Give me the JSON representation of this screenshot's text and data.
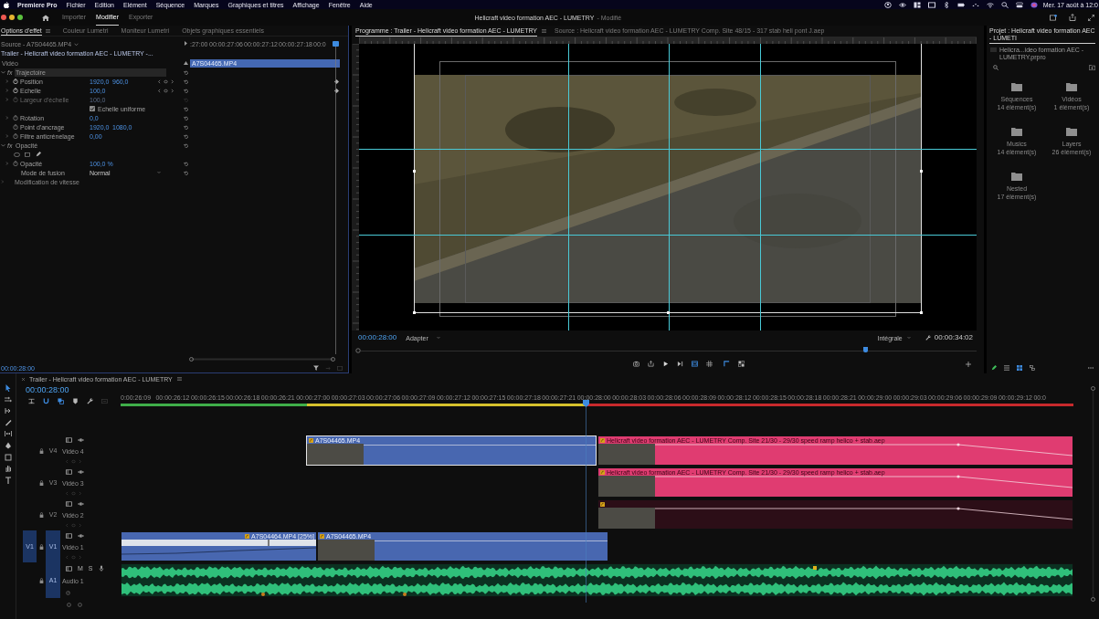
{
  "menu_bar": {
    "app_name": "Premiere Pro",
    "items": [
      "Fichier",
      "Edition",
      "Elément",
      "Séquence",
      "Marques",
      "Graphiques et titres",
      "Affichage",
      "Fenêtre",
      "Aide"
    ],
    "clock": "Mer. 17 août à 12:0"
  },
  "header": {
    "workspaces": [
      {
        "label": "Importer",
        "selected": false
      },
      {
        "label": "Modifier",
        "selected": true
      },
      {
        "label": "Exporter",
        "selected": false
      }
    ],
    "title": "Helicraft video formation AEC - LUMETRY",
    "title_state": "- Modifié"
  },
  "effect_panel": {
    "tabs": [
      {
        "label": "Options d'effet",
        "selected": true
      },
      {
        "label": "Couleur Lumetri",
        "selected": false
      },
      {
        "label": "Moniteur Lumetri",
        "selected": false
      },
      {
        "label": "Objets graphiques essentiels",
        "selected": false
      }
    ],
    "source": "Source - A7S04465.MP4",
    "sequence": "Trailer - Helicraft video formation AEC - LUMETRY -...",
    "rows": [
      {
        "kind": "section",
        "label": "Vidéo"
      },
      {
        "kind": "effect",
        "badge": "fx",
        "label": "Trajectoire",
        "expanded": true,
        "selected": true
      },
      {
        "kind": "param",
        "label": "Position",
        "values": [
          "1920,0",
          "960,0"
        ],
        "expandable": true,
        "animated": true,
        "disabled": false
      },
      {
        "kind": "param",
        "label": "Echelle",
        "values": [
          "100,0"
        ],
        "expandable": true,
        "animated": true,
        "disabled": false
      },
      {
        "kind": "param",
        "label": "Largeur d'échelle",
        "values": [
          "100,0"
        ],
        "expandable": true,
        "animated": false,
        "disabled": true
      },
      {
        "kind": "checkbox",
        "label": "Echelle uniforme",
        "checked": true
      },
      {
        "kind": "param",
        "label": "Rotation",
        "values": [
          "0,0"
        ],
        "expandable": true,
        "animated": false,
        "disabled": false
      },
      {
        "kind": "param",
        "label": "Point d'ancrage",
        "values": [
          "1920,0",
          "1080,0"
        ],
        "expandable": false,
        "animated": false,
        "disabled": false
      },
      {
        "kind": "param",
        "label": "Filtre anticrénelage",
        "values": [
          "0,00"
        ],
        "expandable": true,
        "animated": false,
        "disabled": false
      },
      {
        "kind": "effect",
        "badge": "fx",
        "label": "Opacité",
        "expanded": true,
        "selected": false
      },
      {
        "kind": "masks"
      },
      {
        "kind": "param",
        "label": "Opacité",
        "values": [
          "100,0 %"
        ],
        "expandable": true,
        "animated": false,
        "disabled": false
      },
      {
        "kind": "select",
        "label": "Mode de fusion",
        "value": "Normal"
      },
      {
        "kind": "group",
        "label": "Modification de vitesse",
        "expanded": false
      }
    ],
    "ruler": [
      ":27:00",
      "00:00:27:06",
      "00:00:27:12",
      "00:00:27:18",
      "00:0"
    ],
    "clip": "A7S04465.MP4",
    "timecode": "00:00:28:00"
  },
  "program_monitor": {
    "tabs": [
      {
        "label": "Programme : Trailer - Helicraft video formation AEC - LUMETRY",
        "selected": true
      },
      {
        "label": "Source : Helicraft video formation AEC - LUMETRY Comp. Site 48/15 - 317 stab heli pont J.aep",
        "selected": false
      }
    ],
    "timecode": "00:00:28:00",
    "zoom": "Adapter",
    "resolution": "Intégrale",
    "duration": "00:00:34:02",
    "level": 0.82
  },
  "project_panel": {
    "title": "Projet : Helicraft video formation AEC - LUMETI",
    "file": "Helicra...ideo formation AEC - LUMETRY.prpro",
    "bins": [
      {
        "name": "Séquences",
        "count": "14 élément(s)"
      },
      {
        "name": "Vidéos",
        "count": "1 élément(s)"
      },
      {
        "name": "Musics",
        "count": "14 élément(s)"
      },
      {
        "name": "Layers",
        "count": "26 élément(s)"
      },
      {
        "name": "Nested",
        "count": "17 élément(s)"
      }
    ]
  },
  "timeline": {
    "title": "Trailer - Helicraft video formation AEC - LUMETRY",
    "timecode": "00:00:28:00",
    "ruler": [
      "0:00:26:09",
      "00:00:26:12",
      "00:00:26:15",
      "00:00:26:18",
      "00:00:26:21",
      "00:00:27:00",
      "00:00:27:03",
      "00:00:27:06",
      "00:00:27:09",
      "00:00:27:12",
      "00:00:27:15",
      "00:00:27:18",
      "00:00:27:21",
      "00:00:28:00",
      "00:00:28:03",
      "00:00:28:06",
      "00:00:28:09",
      "00:00:28:12",
      "00:00:28:15",
      "00:00:28:18",
      "00:00:28:21",
      "00:00:29:00",
      "00:00:29:03",
      "00:00:29:06",
      "00:00:29:09",
      "00:00:29:12",
      "00:0"
    ],
    "tracks": [
      {
        "label": "V4",
        "name": "Vidéo 4",
        "kind": "video",
        "targeted": false,
        "clips": [
          {
            "kind": "footage",
            "name": "A7S04465.MP4",
            "color": "#4867b0",
            "selected": true
          },
          {
            "kind": "comp",
            "name": "Helicraft video formation AEC - LUMETRY Comp. Site 21/30 - 29/30 speed ramp helico + stab.aep",
            "color": "#e03c71",
            "selected": false
          }
        ]
      },
      {
        "label": "V3",
        "name": "Vidéo 3",
        "kind": "video",
        "targeted": false,
        "clips": [
          {
            "kind": "comp",
            "name": "Helicraft video formation AEC - LUMETRY Comp. Site 21/30 - 29/30 speed ramp helico + stab.aep",
            "color": "#e03c71",
            "selected": false
          }
        ]
      },
      {
        "label": "V2",
        "name": "Vidéo 2",
        "kind": "video",
        "targeted": false,
        "clips": [
          {
            "kind": "comp",
            "color": "#2c0e17",
            "selected": false
          }
        ]
      },
      {
        "label": "V1",
        "name": "Vidéo 1",
        "kind": "video",
        "source_patch": "V1",
        "targeted": true,
        "clips": [
          {
            "kind": "remapped",
            "name": "A7S04464.MP4 [25%]",
            "color": "#4867b0",
            "selected": false
          },
          {
            "kind": "footage",
            "name": "A7S04465.MP4",
            "color": "#4867b0",
            "selected": false
          }
        ]
      },
      {
        "label": "A1",
        "name": "Audio 1",
        "kind": "audio",
        "targeted": true,
        "buttons": [
          "M",
          "S"
        ],
        "clips": [
          {
            "kind": "audio",
            "color": "#2fbf7a",
            "selected": false
          }
        ]
      }
    ]
  }
}
